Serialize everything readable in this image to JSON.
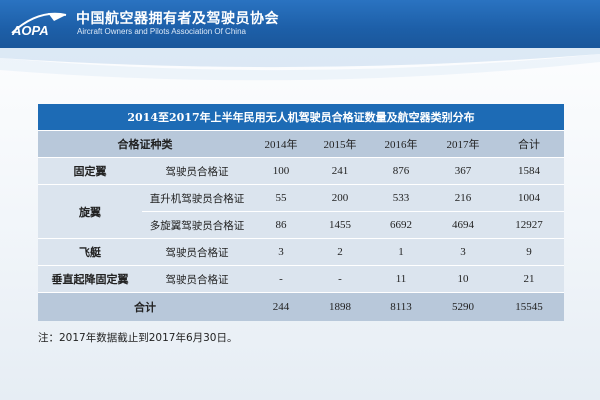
{
  "header": {
    "logo_text": "AOPA",
    "title_cn": "中国航空器拥有者及驾驶员协会",
    "title_en": "Aircraft Owners and Pilots Association Of China"
  },
  "table": {
    "caption": "2014至2017年上半年民用无人机驾驶员合格证数量及航空器类别分布",
    "headers": {
      "type": "合格证种类",
      "years": [
        "2014年",
        "2015年",
        "2016年",
        "2017年"
      ],
      "total": "合计"
    },
    "groups": [
      {
        "name": "固定翼",
        "rows": [
          {
            "sub": "驾驶员合格证",
            "values": [
              "100",
              "241",
              "876",
              "367",
              "1584"
            ]
          }
        ]
      },
      {
        "name": "旋翼",
        "rows": [
          {
            "sub": "直升机驾驶员合格证",
            "values": [
              "55",
              "200",
              "533",
              "216",
              "1004"
            ]
          },
          {
            "sub": "多旋翼驾驶员合格证",
            "values": [
              "86",
              "1455",
              "6692",
              "4694",
              "12927"
            ]
          }
        ]
      },
      {
        "name": "飞艇",
        "rows": [
          {
            "sub": "驾驶员合格证",
            "values": [
              "3",
              "2",
              "1",
              "3",
              "9"
            ]
          }
        ]
      },
      {
        "name": "垂直起降固定翼",
        "rows": [
          {
            "sub": "驾驶员合格证",
            "values": [
              "-",
              "-",
              "11",
              "10",
              "21"
            ]
          }
        ]
      }
    ],
    "total": {
      "label": "合计",
      "values": [
        "244",
        "1898",
        "8113",
        "5290",
        "15545"
      ]
    }
  },
  "note": "注：2017年数据截止到2017年6月30日。",
  "colors": {
    "header_blue": "#1d5fa8",
    "caption_blue": "#1d6bb5",
    "header_row": "#b8c8da",
    "body_row": "#dbe4ee"
  }
}
